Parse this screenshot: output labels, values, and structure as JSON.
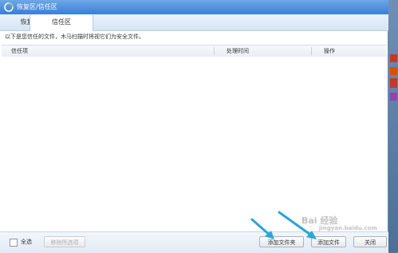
{
  "window": {
    "title": "恢复区/信任区"
  },
  "tabs": [
    {
      "label": "恢复区"
    },
    {
      "label": "信任区"
    }
  ],
  "info_text": "以下是您信任的文件，木马扫描时将视它们为安全文件。",
  "table": {
    "columns": [
      "信任项",
      "处理时间",
      "操作"
    ],
    "rows": []
  },
  "footer": {
    "select_all_label": "全选",
    "remove_label": "移除所选项",
    "add_folder_label": "添加文件夹",
    "add_file_label": "添加文件",
    "close_label": "关闭"
  },
  "watermark": {
    "text": "Bai 经验",
    "sub": "jingyan.baidu.com"
  },
  "colors": {
    "titlebar": "#3a7fd6",
    "arrow": "#2aa6d8"
  }
}
